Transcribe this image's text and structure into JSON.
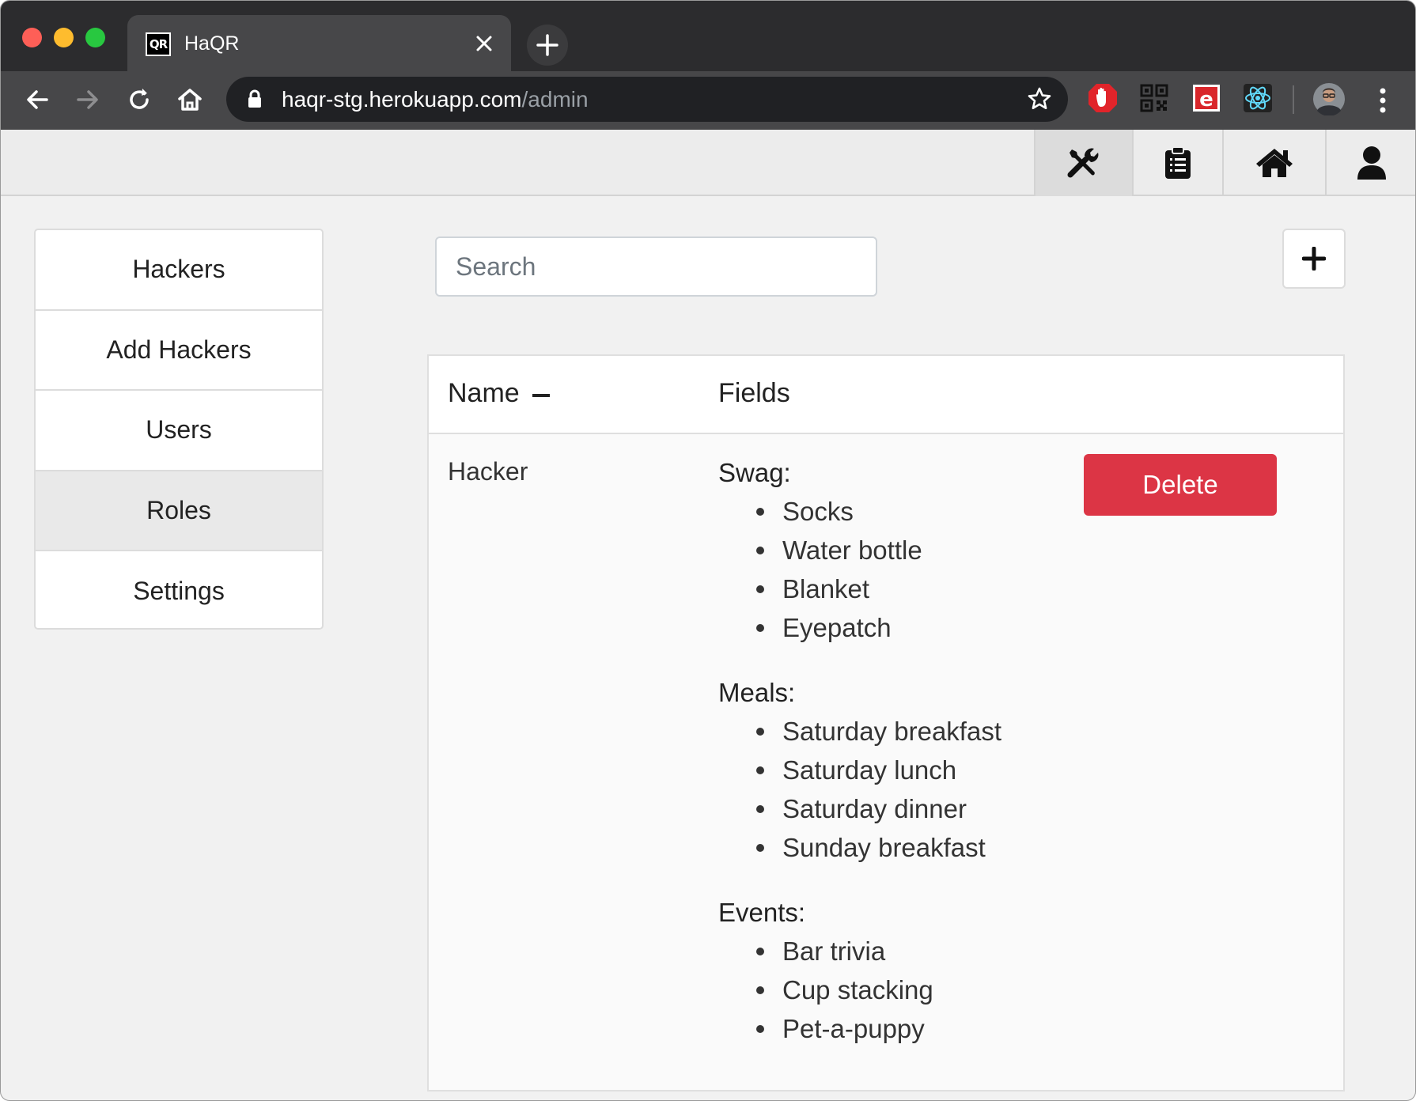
{
  "browser": {
    "tab_title": "HaQR",
    "favicon_text": "QR",
    "url_host": "haqr-stg.herokuapp.com",
    "url_path": "/admin",
    "extensions": [
      "stop-hand-extension-icon",
      "qr-code-extension-icon",
      "e-extension-icon",
      "react-devtools-icon"
    ]
  },
  "header": {
    "buttons": [
      "tools-icon",
      "clipboard-icon",
      "home-icon",
      "user-icon"
    ]
  },
  "sidebar": {
    "items": [
      {
        "label": "Hackers",
        "active": false
      },
      {
        "label": "Add Hackers",
        "active": false
      },
      {
        "label": "Users",
        "active": false
      },
      {
        "label": "Roles",
        "active": true
      },
      {
        "label": "Settings",
        "active": false
      }
    ]
  },
  "search": {
    "placeholder": "Search",
    "value": ""
  },
  "add_button": {
    "icon": "plus-icon"
  },
  "table": {
    "columns": {
      "name": "Name",
      "fields": "Fields"
    },
    "rows": [
      {
        "name": "Hacker",
        "groups": [
          {
            "title": "Swag:",
            "items": [
              "Socks",
              "Water bottle",
              "Blanket",
              "Eyepatch"
            ]
          },
          {
            "title": "Meals:",
            "items": [
              "Saturday breakfast",
              "Saturday lunch",
              "Saturday dinner",
              "Sunday breakfast"
            ]
          },
          {
            "title": "Events:",
            "items": [
              "Bar trivia",
              "Cup stacking",
              "Pet-a-puppy"
            ]
          }
        ],
        "delete_label": "Delete"
      }
    ]
  },
  "colors": {
    "danger": "#dc3545",
    "tab_strip": "#2c2c2e",
    "toolbar": "#474749",
    "omnibox": "#202124"
  }
}
